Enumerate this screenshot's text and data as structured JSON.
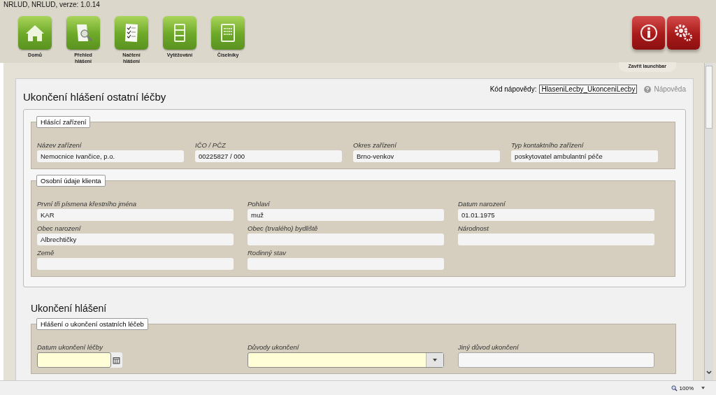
{
  "app_title": "NRLUD, NRLUD, verze: 1.0.14",
  "launcher": [
    {
      "kind": "home",
      "label": "Domů"
    },
    {
      "kind": "search",
      "label": "Přehled hlášení"
    },
    {
      "kind": "checklist",
      "label": "Načtení hlášení"
    },
    {
      "kind": "list",
      "label": "Vytěžování"
    },
    {
      "kind": "codes",
      "label": "Číselníky"
    }
  ],
  "tools": [
    {
      "kind": "info"
    },
    {
      "kind": "settings"
    }
  ],
  "close_launchbar": "Zavřít launchbar",
  "page_title": "Ukončení hlášení ostatní léčby",
  "help_code_label": "Kód nápovědy:",
  "help_code": "HlaseniLecby_UkonceniLecby",
  "help_link": "Nápověda",
  "sections": [
    {
      "legend": "Hlásící zařízení",
      "fields": [
        {
          "label": "Název zařízení",
          "value": "Nemocnice Ivančice, p.o.",
          "kind": "text",
          "required": false
        },
        {
          "label": "IČO / PČZ",
          "value": "00225827 / 000",
          "kind": "text",
          "required": false
        },
        {
          "label": "Okres zařízení",
          "value": "Brno-venkov",
          "kind": "text",
          "required": false
        },
        {
          "label": "Typ kontaktního zařízení",
          "value": "poskytovatel ambulantní péče",
          "kind": "text",
          "required": false
        }
      ]
    },
    {
      "legend": "Osobní údaje klienta",
      "fields": [
        {
          "label": "První tři písmena křestního jména",
          "value": "KAR",
          "kind": "text",
          "required": false
        },
        {
          "label": "Pohlaví",
          "value": "muž",
          "kind": "text",
          "required": false
        },
        {
          "label": "Datum narození",
          "value": "01.01.1975",
          "kind": "text",
          "required": false
        },
        {
          "label": "Obec narození",
          "value": "Albrechtičky",
          "kind": "text",
          "required": false
        },
        {
          "label": "Obec (trvalého) bydliště",
          "kind": "text",
          "required": false
        },
        {
          "label": "Národnost",
          "kind": "text",
          "required": false
        },
        {
          "label": "Země",
          "kind": "text",
          "required": false
        },
        {
          "label": "Rodinný stav",
          "kind": "text",
          "required": false
        }
      ]
    }
  ],
  "end_heading": "Ukončení hlášení",
  "end_sections": [
    {
      "legend": "Hlášení o ukončení ostatních léčeb",
      "fields": [
        {
          "label": "Datum ukončení léčby",
          "kind": "date",
          "required": true
        },
        {
          "label": "Důvody ukončení",
          "kind": "select",
          "required": true
        },
        {
          "label": "Jiný důvod ukončení",
          "kind": "text",
          "required": false
        }
      ]
    }
  ],
  "zoom": "100%"
}
